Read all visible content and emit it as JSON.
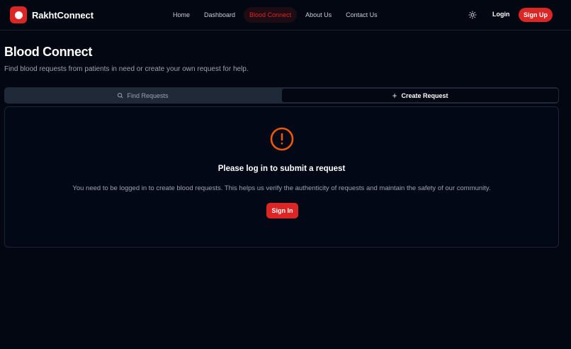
{
  "brand": {
    "name": "RakhtConnect",
    "logo_icon": "blood-drop-logo-icon"
  },
  "nav": {
    "links": [
      {
        "label": "Home",
        "active": false
      },
      {
        "label": "Dashboard",
        "active": false
      },
      {
        "label": "Blood Connect",
        "active": true
      },
      {
        "label": "About Us",
        "active": false
      },
      {
        "label": "Contact Us",
        "active": false
      }
    ],
    "theme_icon": "sun-icon",
    "login_label": "Login",
    "signup_label": "Sign Up"
  },
  "header": {
    "title": "Blood Connect",
    "subtitle": "Find blood requests from patients in need or create your own request for help."
  },
  "tabs": [
    {
      "label": "Find Requests",
      "icon": "search-icon",
      "active": false
    },
    {
      "label": "Create Request",
      "icon": "plus-icon",
      "active": true
    }
  ],
  "card": {
    "icon": "alert-circle-icon",
    "title": "Please log in to submit a request",
    "message": "You need to be logged in to create blood requests. This helps us verify the authenticity of requests and maintain the safety of our community.",
    "button_label": "Sign In"
  },
  "colors": {
    "background": "#030712",
    "accent": "#dc2626",
    "warning": "#ea580c",
    "muted_text": "#9ca3af",
    "border": "#1f2937"
  }
}
